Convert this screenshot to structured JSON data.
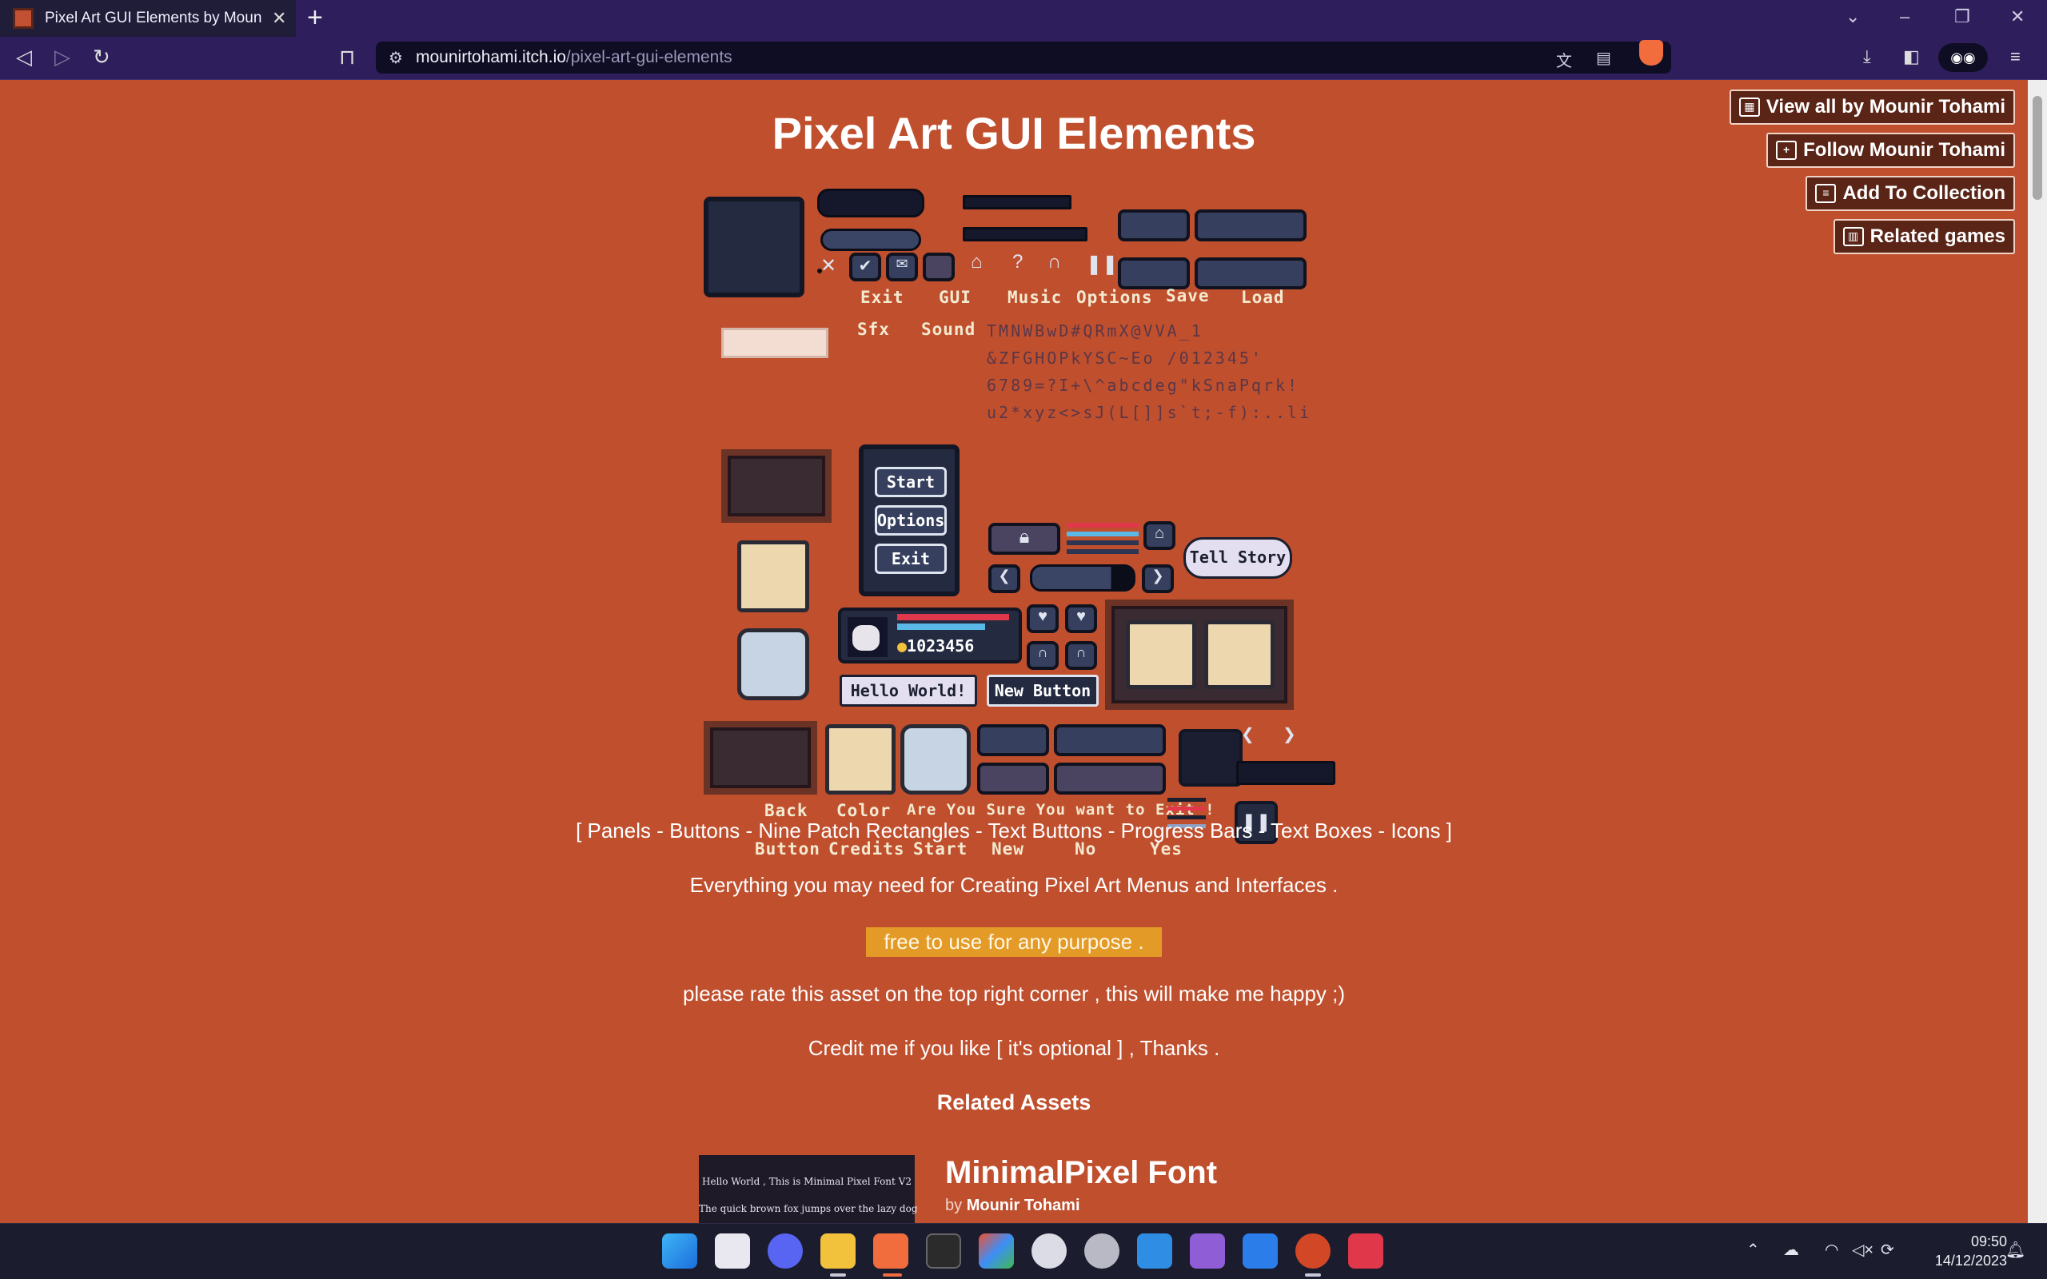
{
  "browser": {
    "tab_title": "Pixel Art GUI Elements by Mounir Tohami",
    "url_host": "mounirtohami.itch.io",
    "url_path": "/pixel-art-gui-elements"
  },
  "user_tools": {
    "view_all": "View all by Mounir Tohami",
    "follow": "Follow Mounir Tohami",
    "add_collection": "Add To Collection",
    "related_games": "Related games"
  },
  "page": {
    "title": "Pixel Art GUI Elements"
  },
  "showcase": {
    "labels_row1": [
      "Exit",
      "GUI",
      "Music",
      "Options",
      "Save",
      "Load"
    ],
    "labels_row2": [
      "Sfx",
      "Sound"
    ],
    "glyph_lines": [
      "TMNWBwD#QRmX@VVA_1",
      "&ZFGHOPkYSC~Eo /012345'",
      "6789=?I+\\^abcdeg\"kSnaPqrk!",
      "u2*xyz<>sJ(L[]]s`t;-f):..li"
    ],
    "menu": [
      "Start",
      "Options",
      "Exit"
    ],
    "tell_story": "Tell Story",
    "coins": "1023456",
    "hello_world": "Hello World!",
    "new_button": "New Button",
    "bottom_row1": [
      "Back",
      "Color",
      "Are You Sure You want to Exit !"
    ],
    "bottom_row2": [
      "Button",
      "Credits",
      "Start",
      "New",
      "No",
      "Yes"
    ]
  },
  "description": {
    "tags": "[ Panels - Buttons - Nine Patch Rectangles - Text Buttons - Progress Bars - Text Boxes - Icons ]",
    "line1": "Everything you may need for Creating Pixel Art Menus and Interfaces .",
    "highlight": "free to use for any purpose .",
    "line2": "please rate this asset on the top right corner , this will make me happy ;)",
    "line3": "Credit me if you like [ it's optional ] , Thanks .",
    "related_heading": "Related Assets"
  },
  "related": {
    "thumb_line1": "Hello World , This is Minimal Pixel Font V2",
    "thumb_line2": "The quick brown fox jumps over the lazy dog",
    "title": "MinimalPixel Font",
    "by": "by",
    "author": "Mounir Tohami"
  },
  "taskbar": {
    "time": "09:50",
    "date": "14/12/2023"
  },
  "colors": {
    "page_bg": "#c04f2e",
    "chrome_bg": "#2e1f5c",
    "highlight": "#e39a26"
  }
}
